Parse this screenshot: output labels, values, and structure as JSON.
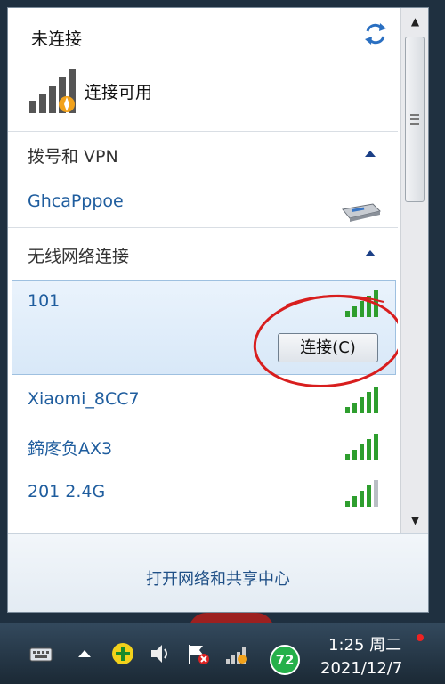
{
  "panel": {
    "header_title": "未连接",
    "status": "连接可用"
  },
  "sections": {
    "vpn": {
      "title": "拨号和 VPN",
      "connection": "GhcaPppoe"
    },
    "wireless": {
      "title": "无线网络连接"
    }
  },
  "networks": [
    {
      "name": "101",
      "signal_bars": 5,
      "selected": true
    },
    {
      "name": "Xiaomi_8CC7",
      "signal_bars": 5
    },
    {
      "name": "鍗庝负AX3",
      "signal_bars": 5
    },
    {
      "name": "201 2.4G",
      "signal_bars": 4
    }
  ],
  "connect_button": "连接(C)",
  "footer_link": "打开网络和共享中心",
  "taskbar": {
    "time": "1:25 周二",
    "date": "2021/12/7",
    "battery_badge": "72"
  },
  "colors": {
    "link_blue": "#1f5d9e",
    "signal_green": "#2e9e2e",
    "annotation_red": "#d81e1e"
  }
}
